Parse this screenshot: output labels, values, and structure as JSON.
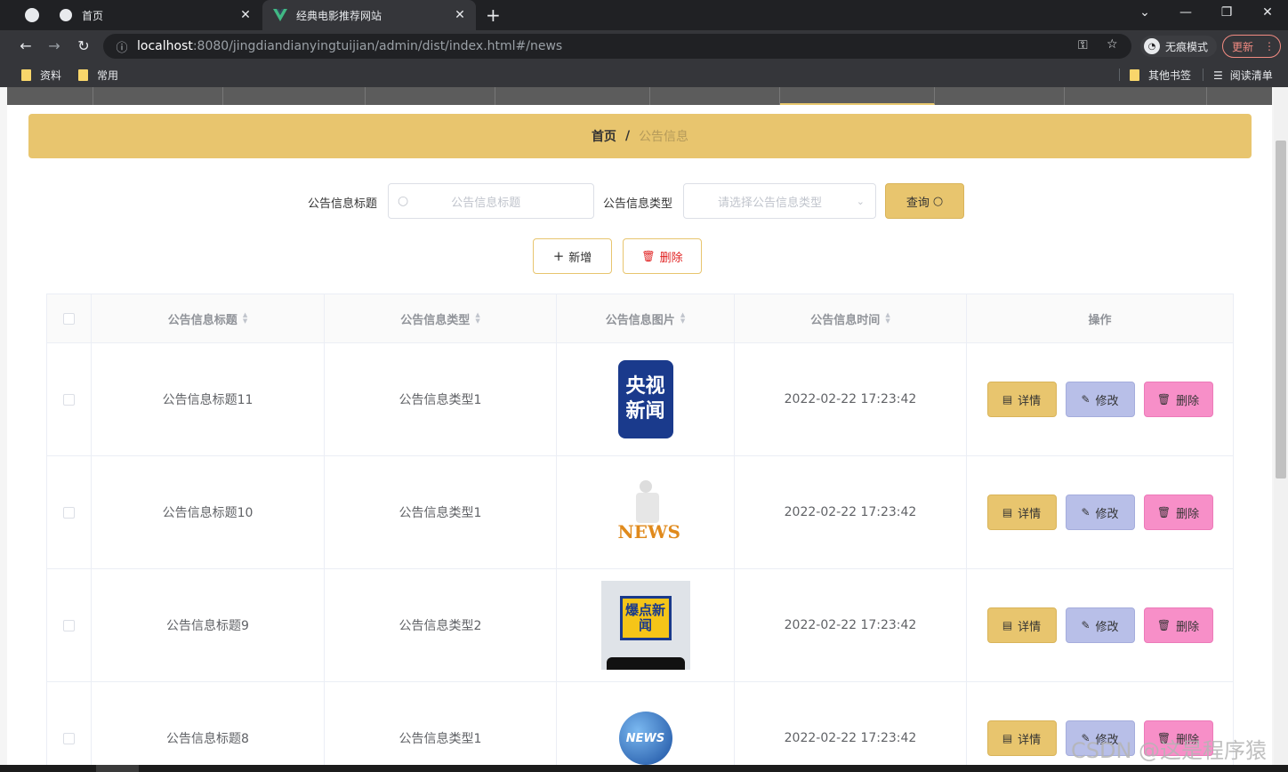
{
  "browser": {
    "tabs": [
      {
        "title": "首页",
        "icon": "globe-icon"
      },
      {
        "title": "经典电影推荐网站",
        "icon": "vue-icon"
      }
    ],
    "url_host": "localhost",
    "url_path": ":8080/jingdiandianyingtuijian/admin/dist/index.html#/news",
    "incognito_label": "无痕模式",
    "update_label": "更新",
    "bookmarks": [
      "资料",
      "常用"
    ],
    "other_bookmarks": "其他书签",
    "reading_list": "阅读清单"
  },
  "breadcrumb": {
    "home": "首页",
    "separator": "/",
    "current": "公告信息"
  },
  "search": {
    "title_label": "公告信息标题",
    "title_placeholder": "公告信息标题",
    "type_label": "公告信息类型",
    "type_placeholder": "请选择公告信息类型",
    "query_label": "查询"
  },
  "toolbar": {
    "add_label": "新增",
    "delete_label": "删除"
  },
  "table": {
    "headers": [
      "公告信息标题",
      "公告信息类型",
      "公告信息图片",
      "公告信息时间",
      "操作"
    ],
    "rows": [
      {
        "title": "公告信息标题11",
        "type": "公告信息类型1",
        "image": "央视新闻",
        "time": "2022-02-22 17:23:42"
      },
      {
        "title": "公告信息标题10",
        "type": "公告信息类型1",
        "image": "NEWS",
        "time": "2022-02-22 17:23:42"
      },
      {
        "title": "公告信息标题9",
        "type": "公告信息类型2",
        "image": "爆点新闻",
        "time": "2022-02-22 17:23:42"
      },
      {
        "title": "公告信息标题8",
        "type": "公告信息类型1",
        "image": "NEWS",
        "time": "2022-02-22 17:23:42"
      }
    ],
    "actions": {
      "detail": "详情",
      "edit": "修改",
      "delete": "删除"
    }
  },
  "watermark": "CSDN @这是程序猿",
  "colors": {
    "accent": "#e8c56e",
    "edit": "#b8bfe8",
    "danger": "#f78fc8",
    "delete_text": "#e02020"
  }
}
